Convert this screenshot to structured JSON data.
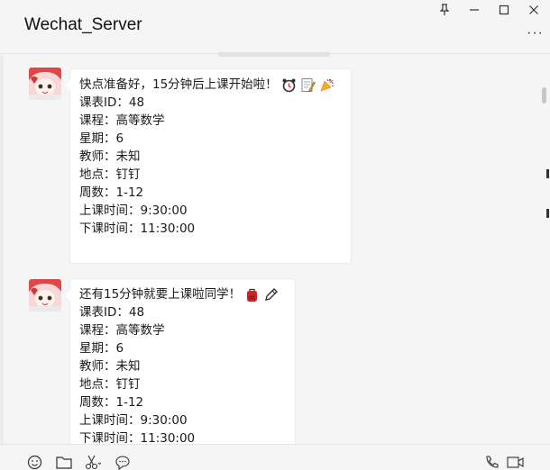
{
  "window": {
    "title": "Wechat_Server",
    "more_label": "···"
  },
  "messages": [
    {
      "lines": [
        "快点准备好，15分钟后上课开始啦！",
        "课表ID：48",
        "课程：高等数学",
        "星期：6",
        "教师：未知",
        "地点：钉钉",
        "周数：1-12",
        "上课时间：9:30:00",
        "下课时间：11:30:00"
      ],
      "emojis": [
        "alarm-clock",
        "memo",
        "party-popper"
      ]
    },
    {
      "lines": [
        "还有15分钟就要上课啦同学！",
        "课表ID：48",
        "课程：高等数学",
        "星期：6",
        "教师：未知",
        "地点：钉钉",
        "周数：1-12",
        "上课时间：9:30:00",
        "下课时间：11:30:00"
      ],
      "emojis": [
        "backpack",
        "pencil"
      ]
    }
  ],
  "toolbar": {
    "icons": [
      "emoji-icon",
      "folder-icon",
      "scissors-icon",
      "chat-history-icon",
      "phone-icon",
      "video-call-icon"
    ]
  }
}
